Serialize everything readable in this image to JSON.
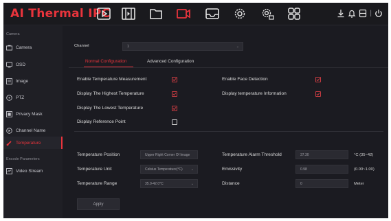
{
  "header": {
    "brand": "AI Thermal IPC",
    "nav_icons": [
      "play-icon",
      "film-icon",
      "folder-icon",
      "camera-record-icon",
      "inbox-icon",
      "settings-gear-icon",
      "gear-network-icon",
      "grid-icon"
    ],
    "right_icons": [
      "download-icon",
      "bell-icon",
      "user-icon",
      "power-icon"
    ],
    "separator": "|",
    "accent_color": "#e8343c"
  },
  "sidebar": {
    "section_camera": "Camera",
    "section_encode": "Encode Parameters",
    "items": [
      {
        "label": "Camera",
        "icon": "camera-icon"
      },
      {
        "label": "OSD",
        "icon": "monitor-icon"
      },
      {
        "label": "Image",
        "icon": "image-icon"
      },
      {
        "label": "PTZ",
        "icon": "ptz-icon"
      },
      {
        "label": "Privacy Mask",
        "icon": "mask-icon"
      },
      {
        "label": "Channel Name",
        "icon": "channel-icon"
      },
      {
        "label": "Temperature",
        "icon": "thermometer-icon"
      },
      {
        "label": "Video Stream",
        "icon": "video-stream-icon"
      }
    ],
    "active_item": "Temperature"
  },
  "main": {
    "channel_label": "Channel",
    "channel_value": "1",
    "tabs": [
      {
        "label": "Normal Configuration",
        "active": true
      },
      {
        "label": "Advanced Configuration",
        "active": false
      }
    ],
    "checkboxes_left": [
      {
        "label": "Enable Temperature Measurement",
        "checked": true
      },
      {
        "label": "Display The Highest Temperature",
        "checked": true
      },
      {
        "label": "Display The Lowest Temperature",
        "checked": true
      },
      {
        "label": "Display Reference Point",
        "checked": false
      }
    ],
    "checkboxes_right": [
      {
        "label": "Enable Face Detection",
        "checked": true
      },
      {
        "label": "Display temperature Information",
        "checked": true
      }
    ],
    "temperature_position_label": "Temperature Position",
    "temperature_position_value": "Upper Right Corner Of Image",
    "temperature_unit_label": "Temperature Unit",
    "temperature_unit_value": "Celsius Temperature(°C)",
    "temperature_range_label": "Temperature Range",
    "temperature_range_value": "35.0-42.0°C",
    "alarm_threshold_label": "Temperature Alarm Threshold",
    "alarm_threshold_value": "37.30",
    "alarm_threshold_unit": "°C (35~42)",
    "emissivity_label": "Emissivity",
    "emissivity_value": "0.98",
    "emissivity_unit": "(0.00~1.00)",
    "distance_label": "Distance",
    "distance_value": "0",
    "distance_unit": "Meter",
    "apply_label": "Apply"
  }
}
